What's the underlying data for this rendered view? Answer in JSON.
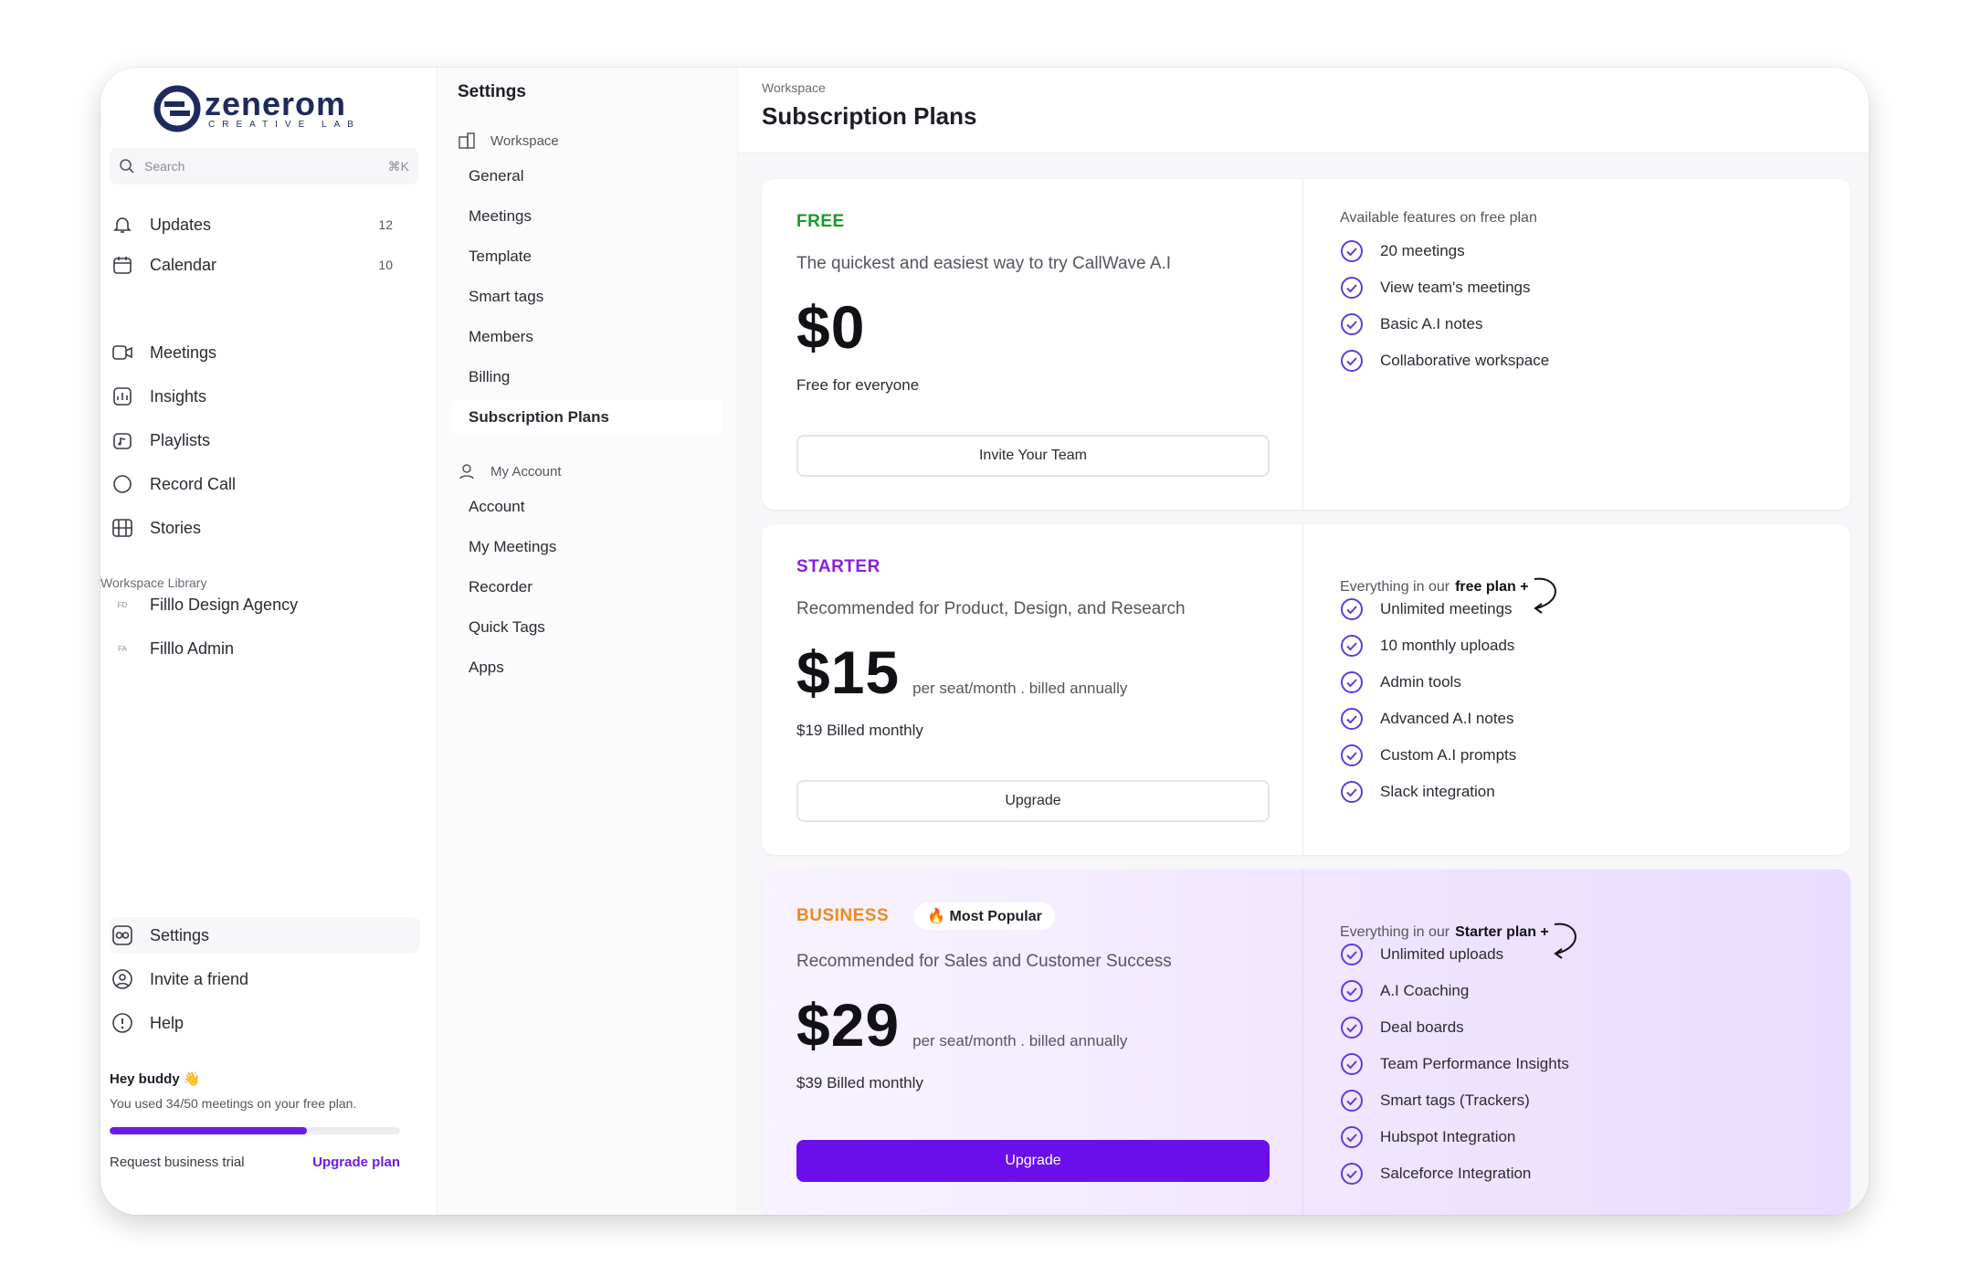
{
  "brand": {
    "name": "zenerom",
    "tagline": "CREATIVE LAB"
  },
  "search": {
    "placeholder": "Search",
    "shortcut": "⌘K"
  },
  "nav": {
    "top": [
      {
        "label": "Updates",
        "count": "12",
        "icon": "bell-icon"
      },
      {
        "label": "Calendar",
        "count": "10",
        "icon": "calendar-icon"
      }
    ],
    "main": [
      {
        "label": "Meetings",
        "icon": "video-icon"
      },
      {
        "label": "Insights",
        "icon": "insights-icon"
      },
      {
        "label": "Playlists",
        "icon": "playlist-icon"
      },
      {
        "label": "Record Call",
        "icon": "record-icon"
      },
      {
        "label": "Stories",
        "icon": "stories-icon"
      }
    ],
    "library_label": "Workspace Library",
    "library": [
      {
        "tag": "FD",
        "label": "Filllo Design Agency"
      },
      {
        "tag": "FA",
        "label": "Filllo Admin"
      }
    ],
    "bottom": [
      {
        "label": "Settings",
        "icon": "settings-icon"
      },
      {
        "label": "Invite a friend",
        "icon": "invite-icon"
      },
      {
        "label": "Help",
        "icon": "help-icon"
      }
    ]
  },
  "promo": {
    "title": "Hey buddy 👋",
    "text": "You used 34/50 meetings on your free plan.",
    "usage_fraction": 0.68,
    "trial_link": "Request business trial",
    "upgrade_link": "Upgrade plan"
  },
  "settings": {
    "title": "Settings",
    "workspace_label": "Workspace",
    "workspace_items": [
      "General",
      "Meetings",
      "Template",
      "Smart tags",
      "Members",
      "Billing",
      "Subscription Plans"
    ],
    "active_item": "Subscription Plans",
    "account_label": "My Account",
    "account_items": [
      "Account",
      "My Meetings",
      "Recorder",
      "Quick Tags",
      "Apps"
    ]
  },
  "main": {
    "breadcrumb": "Workspace",
    "title": "Subscription Plans"
  },
  "plans": {
    "free": {
      "name": "FREE",
      "color": "#1a9a2a",
      "desc": "The quickest and easiest way to try CallWave A.I",
      "price": "$0",
      "sub": "Free for everyone",
      "button": "Invite Your Team",
      "features_head": "Available features on free plan",
      "features": [
        "20 meetings",
        "View team's meetings",
        "Basic A.I notes",
        "Collaborative workspace"
      ]
    },
    "starter": {
      "name": "STARTER",
      "color": "#8a1de0",
      "desc": "Recommended for Product, Design, and Research",
      "price": "$15",
      "price_note": "per seat/month . billed annually",
      "sub": "$19 Billed monthly",
      "button": "Upgrade",
      "features_head": "Everything in our",
      "features_head_bold": "free plan +",
      "features": [
        "Unlimited meetings",
        "10 monthly uploads",
        "Admin tools",
        "Advanced A.I notes",
        "Custom A.I prompts",
        "Slack integration"
      ]
    },
    "business": {
      "name": "BUSINESS",
      "color": "#f08a1a",
      "badge": "🔥 Most Popular",
      "desc": "Recommended for Sales and Customer Success",
      "price": "$29",
      "price_note": "per seat/month . billed annually",
      "sub": "$39 Billed monthly",
      "button": "Upgrade",
      "features_head": "Everything in our",
      "features_head_bold": "Starter plan +",
      "features": [
        "Unlimited uploads",
        "A.I Coaching",
        "Deal boards",
        "Team Performance Insights",
        "Smart tags (Trackers)",
        "Hubspot Integration",
        "Salceforce Integration"
      ]
    }
  },
  "colors": {
    "accent": "#6a0fe9",
    "check": "#5b3fd6"
  }
}
